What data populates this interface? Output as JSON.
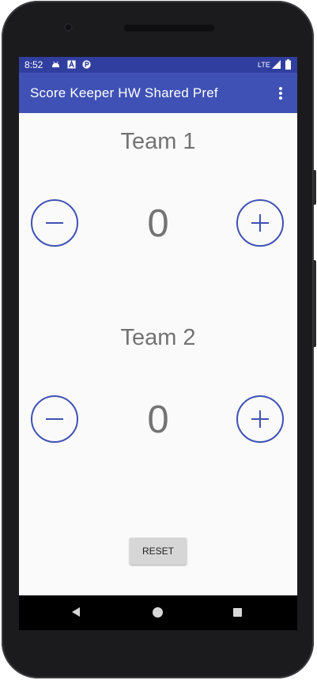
{
  "status_bar": {
    "time": "8:52",
    "network": "LTE",
    "icons": [
      "android-icon",
      "notification-a-icon",
      "notification-p-icon",
      "lte-signal-icon",
      "battery-icon"
    ]
  },
  "app_bar": {
    "title": "Score Keeper HW Shared Pref",
    "overflow_icon": "more-vert-icon"
  },
  "teams": [
    {
      "label": "Team 1",
      "score": "0",
      "decrease_icon": "minus-icon",
      "increase_icon": "plus-icon"
    },
    {
      "label": "Team 2",
      "score": "0",
      "decrease_icon": "minus-icon",
      "increase_icon": "plus-icon"
    }
  ],
  "reset_label": "RESET",
  "nav": {
    "back_icon": "back-icon",
    "home_icon": "home-icon",
    "recents_icon": "recents-icon"
  },
  "colors": {
    "primary": "#3f51b5",
    "primary_dark": "#303f9f",
    "text_gray": "#737373",
    "background": "#fafafa"
  }
}
